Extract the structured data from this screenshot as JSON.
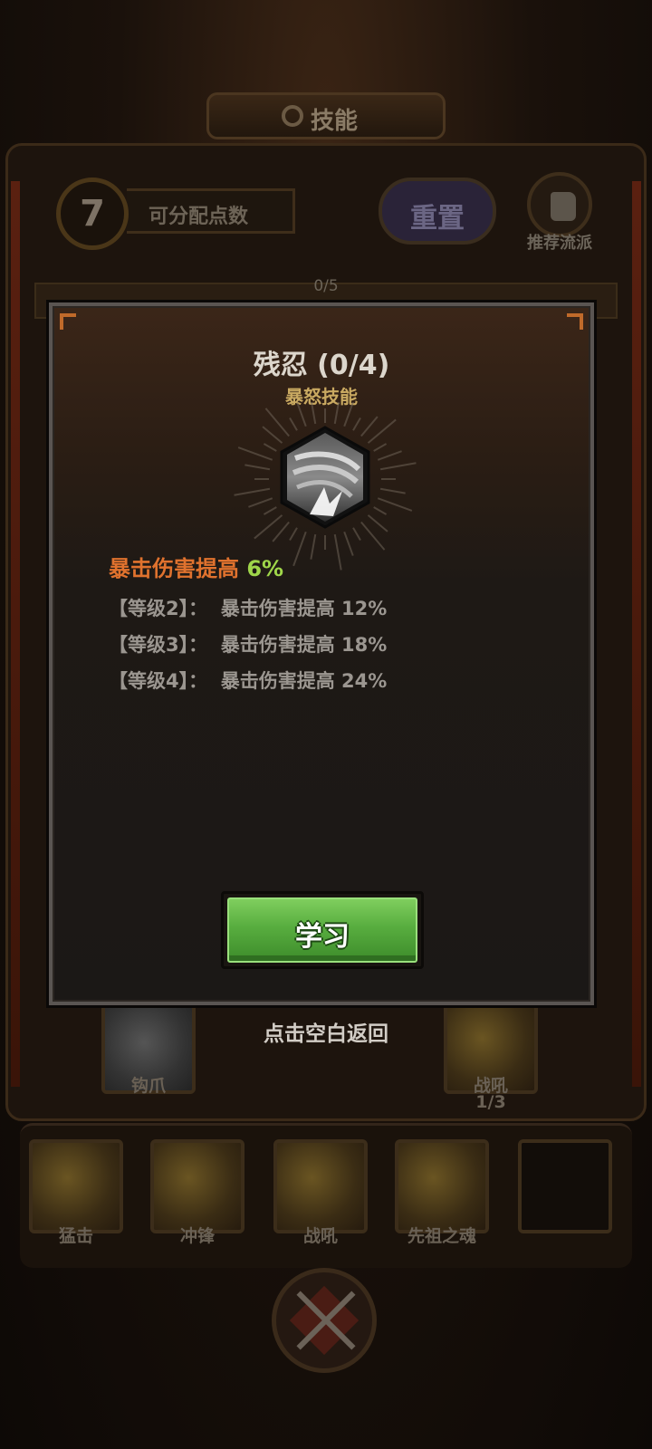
{
  "screen": {
    "title": "技能",
    "points": "7",
    "points_label": "可分配点数",
    "reset_label": "重置",
    "recommend_label": "推荐流派",
    "progress": "0/5"
  },
  "background_skills": [
    {
      "label": "钩爪",
      "sub": ""
    },
    {
      "label": "战吼",
      "sub": "1/3"
    }
  ],
  "bottom_skills": [
    {
      "label": "猛击"
    },
    {
      "label": "冲锋"
    },
    {
      "label": "战吼"
    },
    {
      "label": "先祖之魂"
    },
    {
      "label": ""
    }
  ],
  "modal": {
    "title": "残忍 (0/4)",
    "subtitle": "暴怒技能",
    "icon": "claw-slash-icon",
    "effect_text": "暴击伤害提高",
    "effect_value": "6%",
    "levels": [
      "【等级2】：  暴击伤害提高 12%",
      "【等级3】：  暴击伤害提高 18%",
      "【等级4】：  暴击伤害提高 24%"
    ],
    "learn_label": "学习"
  },
  "hint": "点击空白返回",
  "colors": {
    "effect_orange": "#e0722e",
    "effect_value_green": "#9fd64a",
    "subtitle_gold": "#c9a961",
    "learn_green": "#58ad3f"
  }
}
